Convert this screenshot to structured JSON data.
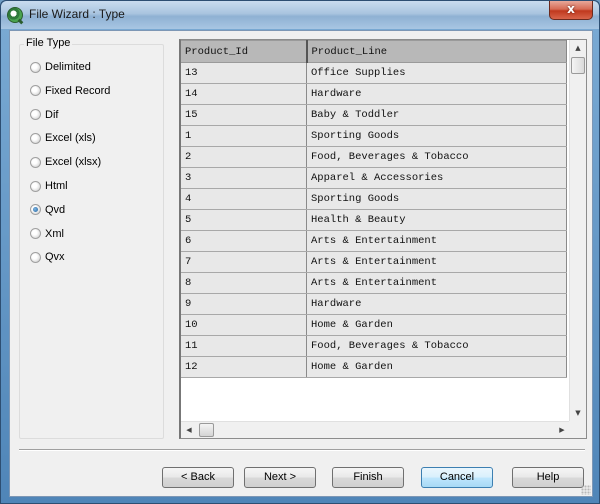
{
  "window": {
    "title": "File Wizard : Type",
    "app_icon": "qlikview-icon",
    "close_label": "x"
  },
  "file_type": {
    "group_label": "File Type",
    "selected": "Qvd",
    "options": [
      {
        "label": "Delimited",
        "checked": false
      },
      {
        "label": "Fixed Record",
        "checked": false
      },
      {
        "label": "Dif",
        "checked": false
      },
      {
        "label": "Excel (xls)",
        "checked": false
      },
      {
        "label": "Excel (xlsx)",
        "checked": false
      },
      {
        "label": "Html",
        "checked": false
      },
      {
        "label": "Qvd",
        "checked": true
      },
      {
        "label": "Xml",
        "checked": false
      },
      {
        "label": "Qvx",
        "checked": false
      }
    ]
  },
  "preview": {
    "columns": [
      "Product_Id",
      "Product_Line"
    ],
    "rows": [
      [
        "13",
        "Office Supplies"
      ],
      [
        "14",
        "Hardware"
      ],
      [
        "15",
        "Baby & Toddler"
      ],
      [
        "1",
        "Sporting Goods"
      ],
      [
        "2",
        "Food, Beverages & Tobacco"
      ],
      [
        "3",
        "Apparel & Accessories"
      ],
      [
        "4",
        "Sporting Goods"
      ],
      [
        "5",
        "Health & Beauty"
      ],
      [
        "6",
        "Arts & Entertainment"
      ],
      [
        "7",
        "Arts & Entertainment"
      ],
      [
        "8",
        "Arts & Entertainment"
      ],
      [
        "9",
        "Hardware"
      ],
      [
        "10",
        "Home & Garden"
      ],
      [
        "11",
        "Food, Beverages & Tobacco"
      ],
      [
        "12",
        "Home & Garden"
      ]
    ],
    "scroll_icons": {
      "up": "▲",
      "down": "▼",
      "left": "◀",
      "right": "▶"
    }
  },
  "buttons": {
    "back": "< Back",
    "next": "Next >",
    "finish": "Finish",
    "cancel": "Cancel",
    "help": "Help"
  }
}
